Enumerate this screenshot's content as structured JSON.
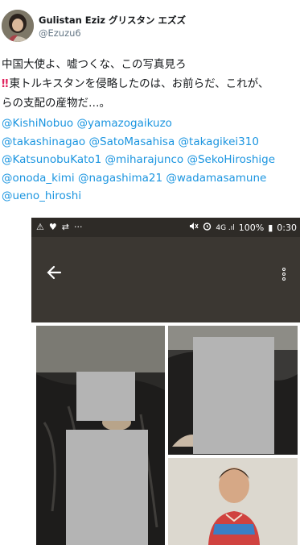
{
  "author": {
    "display_name": "Gulistan Eziz グリスタン エズズ",
    "handle": "@Ezuzu6"
  },
  "tweet": {
    "line1": "中国大使よ、嘘つくな、この写真見ろ",
    "alert_icon": "‼",
    "line2": "東トルキスタンを侵略したのは、お前らだ、これが、",
    "line3": "らの支配の産物だ…。"
  },
  "mentions": [
    [
      "@KishiNobuo",
      "@yamazogaikuzo"
    ],
    [
      "@takashinagao",
      "@SatoMasahisa",
      "@takagikei310"
    ],
    [
      "@KatsunobuKato1",
      "@miharajunco",
      "@SekoHiroshige"
    ],
    [
      "@onoda_kimi",
      "@nagashima21",
      "@wadamasamune"
    ],
    [
      "@ueno_hiroshi"
    ]
  ],
  "phone": {
    "status_left": [
      "⚠",
      "♥",
      "⇄",
      "···"
    ],
    "status_right": {
      "icons": [
        "🔇",
        "⏰"
      ],
      "network": "4G .ıl",
      "battery": "100%",
      "battery_icon": "▮",
      "time": "0:30"
    },
    "back_icon": "arrow-back-icon",
    "menu_icon": "kebab-menu-icon"
  }
}
